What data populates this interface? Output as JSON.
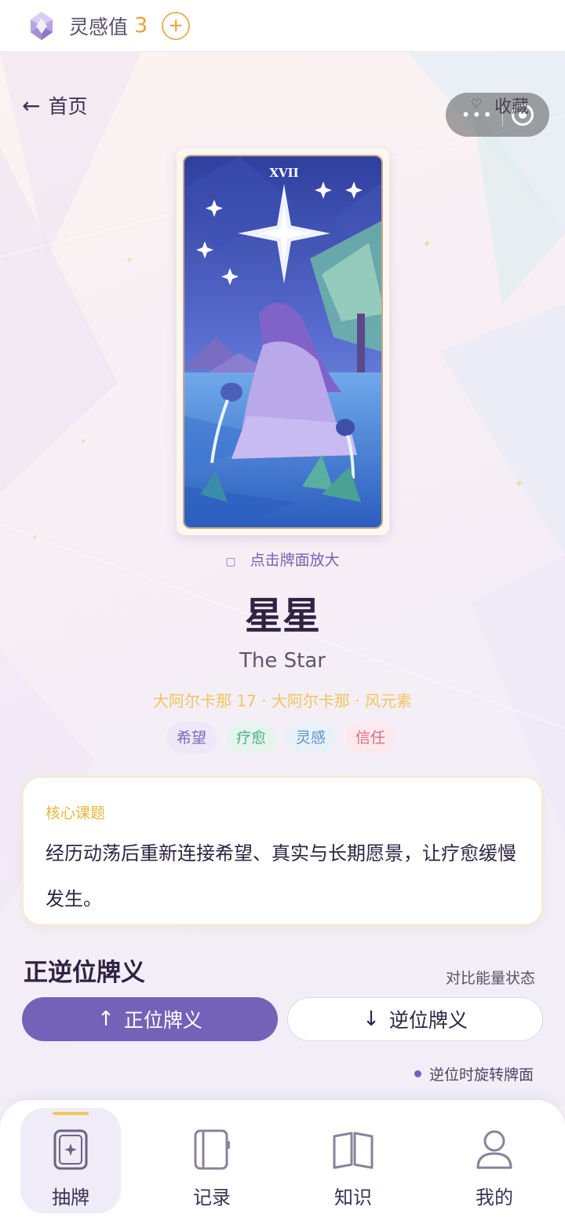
{
  "topbar": {
    "label": "灵感值",
    "count": "3",
    "plus": "+"
  },
  "header": {
    "back_arrow": "←",
    "back_label": "首页",
    "favorite_label": "收藏",
    "capsule_dots": "•••"
  },
  "card": {
    "numeral": "XVII",
    "zoom_hint": "点击牌面放大",
    "title": "星星",
    "english": "The Star",
    "meta": "大阿尔卡那 17 · 大阿尔卡那 · 风元素",
    "tags": [
      "希望",
      "疗愈",
      "灵感",
      "信任"
    ]
  },
  "core": {
    "label": "核心课题",
    "text": "经历动荡后重新连接希望、真实与长期愿景，让疗愈缓慢发生。"
  },
  "meanings": {
    "title": "正逆位牌义",
    "subtitle": "对比能量状态",
    "upright_arrow": "↑",
    "upright_label": "正位牌义",
    "reversed_arrow": "↓",
    "reversed_label": "逆位牌义",
    "note": "逆位时旋转牌面"
  },
  "nav": {
    "items": [
      {
        "label": "抽牌",
        "icon": "card-icon",
        "active": true
      },
      {
        "label": "记录",
        "icon": "notebook-icon",
        "active": false
      },
      {
        "label": "知识",
        "icon": "book-icon",
        "active": false
      },
      {
        "label": "我的",
        "icon": "user-icon",
        "active": false
      }
    ]
  },
  "colors": {
    "accent": "#7462b8",
    "gold": "#e6a33a",
    "meta_gold": "#f0c560"
  }
}
